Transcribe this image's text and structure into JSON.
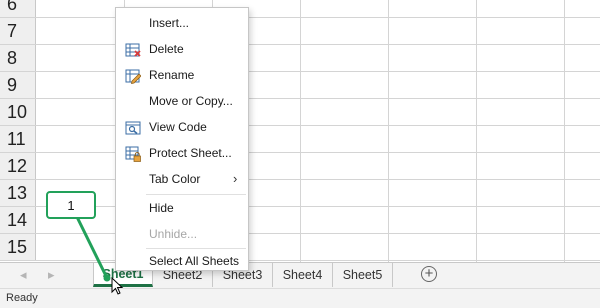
{
  "grid": {
    "row_numbers": [
      "6",
      "7",
      "8",
      "9",
      "10",
      "11",
      "12",
      "13",
      "14",
      "15"
    ]
  },
  "context_menu": {
    "items": [
      {
        "label": "Insert...",
        "icon": "",
        "disabled": false
      },
      {
        "label": "Delete",
        "icon": "delete-sheet-icon",
        "disabled": false
      },
      {
        "label": "Rename",
        "icon": "rename-sheet-icon",
        "disabled": false
      },
      {
        "label": "Move or Copy...",
        "icon": "",
        "disabled": false
      },
      {
        "label": "View Code",
        "icon": "view-code-icon",
        "disabled": false
      },
      {
        "label": "Protect Sheet...",
        "icon": "protect-sheet-icon",
        "disabled": false
      },
      {
        "label": "Tab Color",
        "icon": "",
        "disabled": false,
        "submenu": true
      },
      {
        "label": "Hide",
        "icon": "",
        "disabled": false
      },
      {
        "label": "Unhide...",
        "icon": "",
        "disabled": true
      },
      {
        "label": "Select All Sheets",
        "icon": "",
        "disabled": false
      }
    ]
  },
  "sheet_tabs": {
    "tabs": [
      {
        "label": "Sheet1",
        "active": true
      },
      {
        "label": "Sheet2",
        "active": false
      },
      {
        "label": "Sheet3",
        "active": false
      },
      {
        "label": "Sheet4",
        "active": false
      },
      {
        "label": "Sheet5",
        "active": false
      }
    ],
    "add_label": "+",
    "prev_arrow": "◂",
    "next_arrow": "▸"
  },
  "callout": {
    "label": "1"
  },
  "status_bar": {
    "status": "Ready"
  },
  "colors": {
    "accent": "#1e7145",
    "callout_border": "#22a15a"
  }
}
